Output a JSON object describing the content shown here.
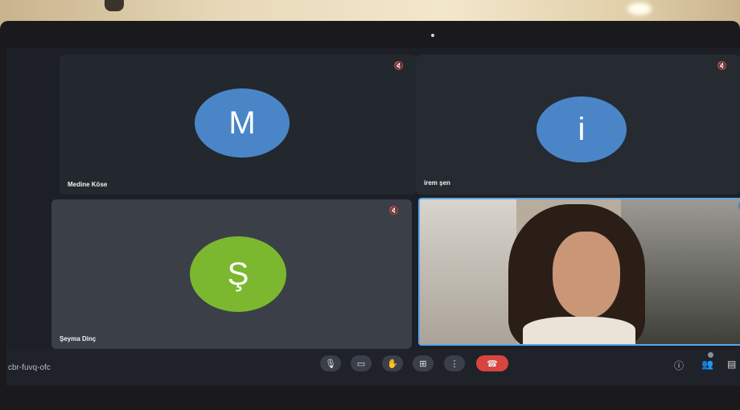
{
  "participants": [
    {
      "name": "Medine Köse",
      "initial": "M",
      "avatar_color": "#4a86c7",
      "muted": true
    },
    {
      "name": "irem şen",
      "initial": "i",
      "avatar_color": "#4a86c7",
      "muted": true
    },
    {
      "name": "Şeyma Dinç",
      "initial": "Ş",
      "avatar_color": "#7cb82f",
      "muted": true
    },
    {
      "name": "",
      "video": true,
      "muted": false
    }
  ],
  "toolbar": {
    "meeting_code": "cbr-fuvq-ofc",
    "mic_icon": "🎙",
    "camera_icon": "▭",
    "hand_icon": "✋",
    "present_icon": "⊞",
    "more_icon": "⋮",
    "end_icon": "☎",
    "info_icon": "ⓘ",
    "people_icon": "👥",
    "chat_icon": "▤"
  },
  "icons": {
    "mute": "🔇"
  },
  "colors": {
    "accent": "#5aa6e8",
    "end_call": "#d9453e"
  }
}
